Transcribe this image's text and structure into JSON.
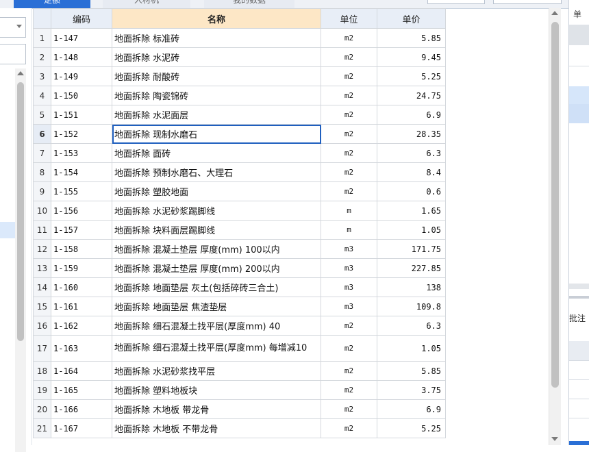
{
  "tabs": [
    "定额",
    "人材机",
    "我的数据"
  ],
  "grid": {
    "headers": {
      "code": "编码",
      "name": "名称",
      "unit": "单位",
      "price": "单价"
    },
    "selected_row": 6,
    "rows": [
      {
        "n": "1",
        "code": "1-147",
        "name": "地面拆除 标准砖",
        "unit": "m2",
        "price": "5.85"
      },
      {
        "n": "2",
        "code": "1-148",
        "name": "地面拆除 水泥砖",
        "unit": "m2",
        "price": "9.45"
      },
      {
        "n": "3",
        "code": "1-149",
        "name": "地面拆除 耐酸砖",
        "unit": "m2",
        "price": "5.25"
      },
      {
        "n": "4",
        "code": "1-150",
        "name": "地面拆除 陶瓷锦砖",
        "unit": "m2",
        "price": "24.75"
      },
      {
        "n": "5",
        "code": "1-151",
        "name": "地面拆除 水泥面层",
        "unit": "m2",
        "price": "6.9"
      },
      {
        "n": "6",
        "code": "1-152",
        "name": "地面拆除 现制水磨石",
        "unit": "m2",
        "price": "28.35"
      },
      {
        "n": "7",
        "code": "1-153",
        "name": "地面拆除 面砖",
        "unit": "m2",
        "price": "6.3"
      },
      {
        "n": "8",
        "code": "1-154",
        "name": "地面拆除 预制水磨石、大理石",
        "unit": "m2",
        "price": "8.4"
      },
      {
        "n": "9",
        "code": "1-155",
        "name": "地面拆除 塑胶地面",
        "unit": "m2",
        "price": "0.6"
      },
      {
        "n": "10",
        "code": "1-156",
        "name": "地面拆除 水泥砂浆踢脚线",
        "unit": "m",
        "price": "1.65"
      },
      {
        "n": "11",
        "code": "1-157",
        "name": "地面拆除 块料面层踢脚线",
        "unit": "m",
        "price": "1.05"
      },
      {
        "n": "12",
        "code": "1-158",
        "name": "地面拆除 混凝土垫层 厚度(mm) 100以内",
        "unit": "m3",
        "price": "171.75"
      },
      {
        "n": "13",
        "code": "1-159",
        "name": "地面拆除 混凝土垫层 厚度(mm) 200以内",
        "unit": "m3",
        "price": "227.85"
      },
      {
        "n": "14",
        "code": "1-160",
        "name": "地面拆除 地面垫层 灰土(包括碎砖三合土)",
        "unit": "m3",
        "price": "138"
      },
      {
        "n": "15",
        "code": "1-161",
        "name": "地面拆除 地面垫层 焦渣垫层",
        "unit": "m3",
        "price": "109.8"
      },
      {
        "n": "16",
        "code": "1-162",
        "name": "地面拆除 细石混凝土找平层(厚度mm) 40",
        "unit": "m2",
        "price": "6.3"
      },
      {
        "n": "17",
        "code": "1-163",
        "name": "地面拆除 细石混凝土找平层(厚度mm) 每增减10",
        "unit": "m2",
        "price": "1.05"
      },
      {
        "n": "18",
        "code": "1-164",
        "name": "地面拆除 水泥砂浆找平层",
        "unit": "m2",
        "price": "5.85"
      },
      {
        "n": "19",
        "code": "1-165",
        "name": "地面拆除 塑料地板块",
        "unit": "m2",
        "price": "3.75"
      },
      {
        "n": "20",
        "code": "1-166",
        "name": "地面拆除 木地板 带龙骨",
        "unit": "m2",
        "price": "6.9"
      },
      {
        "n": "21",
        "code": "1-167",
        "name": "地面拆除 木地板 不带龙骨",
        "unit": "m2",
        "price": "5.25"
      }
    ]
  },
  "right_panel": {
    "header": "单",
    "batch_label": "批注"
  },
  "colors": {
    "tab_active": "#2a6fd6",
    "name_header": "#fde7c6",
    "selection": "#1f5fbf"
  }
}
